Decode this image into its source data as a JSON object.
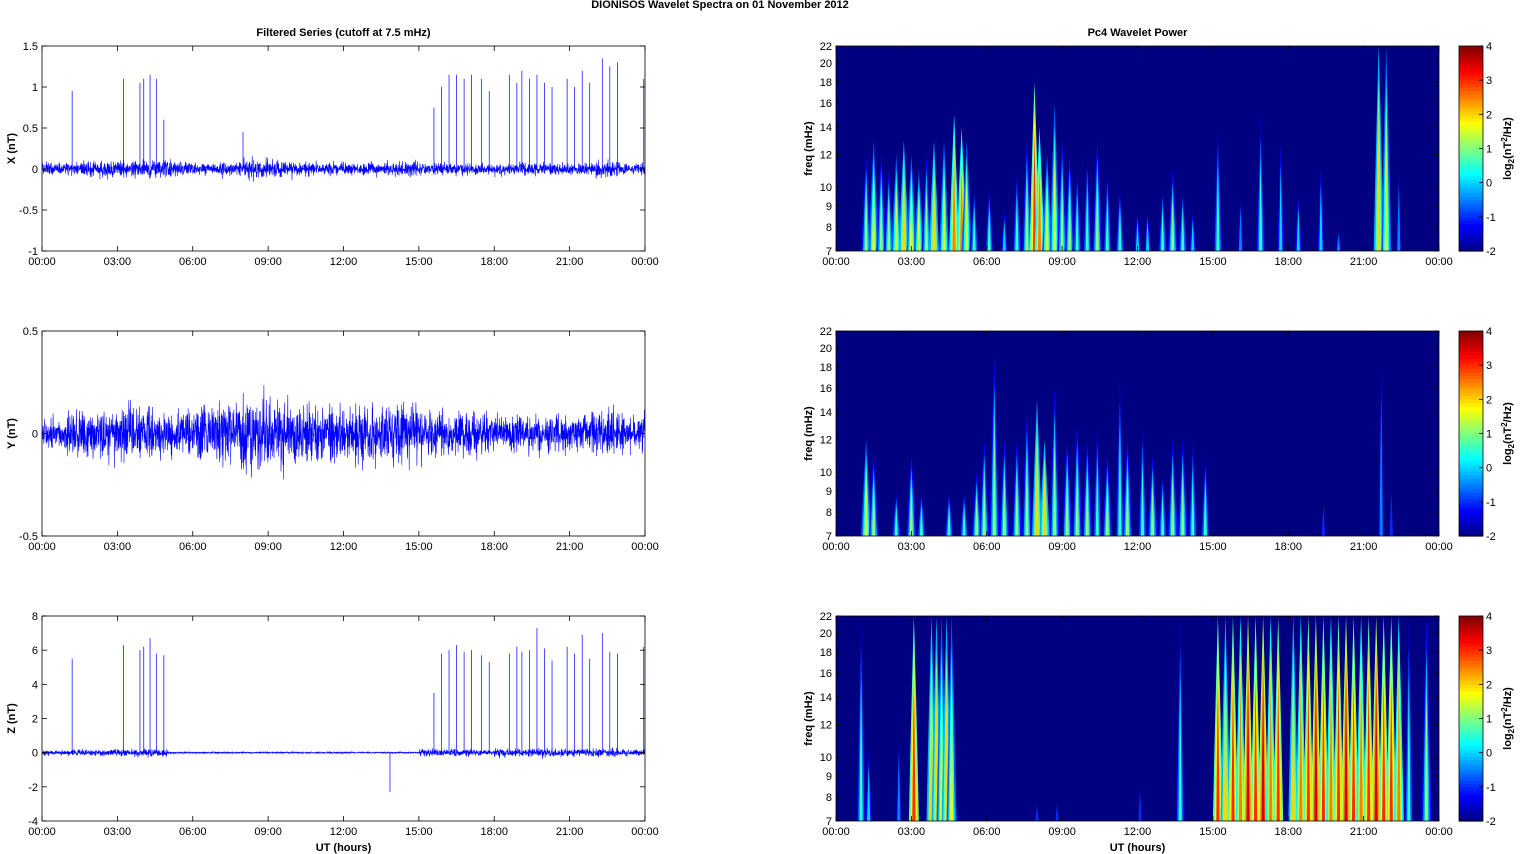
{
  "title": "DIONISOS Wavelet Spectra on 01 November  2012",
  "chart_data": [
    {
      "type": "line",
      "title": "Filtered Series (cutoff at 7.5 mHz)",
      "ylabel": "X (nT)",
      "xlabel": "",
      "xlim": [
        0,
        24
      ],
      "xticks": [
        "00:00",
        "03:00",
        "06:00",
        "09:00",
        "12:00",
        "15:00",
        "18:00",
        "21:00",
        "00:00"
      ],
      "ylim": [
        -1,
        1.5
      ],
      "yticks": [
        "-1",
        "-0.5",
        "0",
        "0.5",
        "1",
        "1.5"
      ],
      "color": "#0000ff",
      "noise_amplitude_hourly": [
        0.05,
        0.06,
        0.07,
        0.07,
        0.08,
        0.07,
        0.05,
        0.06,
        0.08,
        0.07,
        0.06,
        0.05,
        0.05,
        0.05,
        0.06,
        0.05,
        0.05,
        0.05,
        0.05,
        0.05,
        0.05,
        0.05,
        0.07,
        0.05
      ],
      "spikes": [
        [
          1.2,
          0.95
        ],
        [
          3.25,
          1.1
        ],
        [
          3.9,
          1.05
        ],
        [
          4.05,
          1.1
        ],
        [
          4.3,
          1.15
        ],
        [
          4.55,
          1.1
        ],
        [
          4.85,
          0.6
        ],
        [
          8.0,
          0.45
        ],
        [
          15.6,
          0.75
        ],
        [
          15.9,
          1.0
        ],
        [
          16.2,
          1.15
        ],
        [
          16.5,
          1.15
        ],
        [
          16.8,
          1.1
        ],
        [
          17.1,
          1.15
        ],
        [
          17.5,
          1.1
        ],
        [
          17.8,
          0.95
        ],
        [
          18.6,
          1.15
        ],
        [
          18.9,
          1.05
        ],
        [
          19.1,
          1.2
        ],
        [
          19.4,
          1.1
        ],
        [
          19.7,
          1.15
        ],
        [
          20.0,
          1.05
        ],
        [
          20.3,
          1.0
        ],
        [
          20.9,
          1.1
        ],
        [
          21.2,
          1.0
        ],
        [
          21.5,
          1.2
        ],
        [
          21.8,
          1.05
        ],
        [
          22.3,
          1.35
        ],
        [
          22.6,
          1.25
        ],
        [
          22.9,
          1.3
        ],
        [
          23.95,
          1.1
        ]
      ]
    },
    {
      "type": "line",
      "title": "",
      "ylabel": "Y (nT)",
      "xlabel": "",
      "xlim": [
        0,
        24
      ],
      "xticks": [
        "00:00",
        "03:00",
        "06:00",
        "09:00",
        "12:00",
        "15:00",
        "18:00",
        "21:00",
        "00:00"
      ],
      "ylim": [
        -0.5,
        0.5
      ],
      "yticks": [
        "-0.5",
        "0",
        "0.5"
      ],
      "color": "#0000ff",
      "noise_amplitude_hourly": [
        0.05,
        0.09,
        0.08,
        0.09,
        0.08,
        0.08,
        0.09,
        0.1,
        0.12,
        0.11,
        0.1,
        0.09,
        0.1,
        0.1,
        0.1,
        0.08,
        0.07,
        0.07,
        0.06,
        0.06,
        0.06,
        0.06,
        0.08,
        0.06
      ],
      "spikes": []
    },
    {
      "type": "line",
      "title": "",
      "ylabel": "Z (nT)",
      "xlabel": "UT (hours)",
      "xlim": [
        0,
        24
      ],
      "xticks": [
        "00:00",
        "03:00",
        "06:00",
        "09:00",
        "12:00",
        "15:00",
        "18:00",
        "21:00",
        "00:00"
      ],
      "ylim": [
        -4,
        8
      ],
      "yticks": [
        "-4",
        "-2",
        "0",
        "2",
        "4",
        "6",
        "8"
      ],
      "color": "#0000ff",
      "noise_amplitude_hourly": [
        0.1,
        0.12,
        0.13,
        0.15,
        0.16,
        0.04,
        0.03,
        0.03,
        0.03,
        0.03,
        0.03,
        0.03,
        0.03,
        0.03,
        0.03,
        0.15,
        0.15,
        0.12,
        0.18,
        0.18,
        0.18,
        0.17,
        0.17,
        0.12
      ],
      "spikes": [
        [
          1.2,
          5.5
        ],
        [
          3.25,
          6.3
        ],
        [
          3.9,
          6.0
        ],
        [
          4.05,
          6.2
        ],
        [
          4.3,
          6.7
        ],
        [
          4.55,
          5.8
        ],
        [
          4.85,
          5.7
        ],
        [
          13.85,
          -2.3
        ],
        [
          15.6,
          3.5
        ],
        [
          15.9,
          5.8
        ],
        [
          16.2,
          6.0
        ],
        [
          16.5,
          6.3
        ],
        [
          16.8,
          5.9
        ],
        [
          17.1,
          6.0
        ],
        [
          17.5,
          5.7
        ],
        [
          17.8,
          5.3
        ],
        [
          18.6,
          5.8
        ],
        [
          18.9,
          6.2
        ],
        [
          19.1,
          5.9
        ],
        [
          19.4,
          6.0
        ],
        [
          19.7,
          7.3
        ],
        [
          20.0,
          6.1
        ],
        [
          20.3,
          5.4
        ],
        [
          20.9,
          6.2
        ],
        [
          21.2,
          5.8
        ],
        [
          21.5,
          6.9
        ],
        [
          21.8,
          5.5
        ],
        [
          22.3,
          7.0
        ],
        [
          22.6,
          5.9
        ],
        [
          22.9,
          5.8
        ],
        [
          23.95,
          6.2
        ]
      ]
    },
    {
      "type": "heatmap",
      "title": "Pc4 Wavelet Power",
      "ylabel": "freq (mHz)",
      "xlabel": "",
      "xlim": [
        0,
        24
      ],
      "xticks": [
        "00:00",
        "03:00",
        "06:00",
        "09:00",
        "12:00",
        "15:00",
        "18:00",
        "21:00",
        "00:00"
      ],
      "ylim": [
        7,
        22
      ],
      "yscale": "log",
      "yticks": [
        7,
        8,
        9,
        10,
        12,
        14,
        16,
        18,
        20,
        22
      ],
      "background_power": -2,
      "bursts_t_fmax_power": [
        [
          1.2,
          12,
          1
        ],
        [
          1.5,
          13,
          1.5
        ],
        [
          1.8,
          12,
          1
        ],
        [
          2.1,
          11,
          1
        ],
        [
          2.4,
          12,
          1.5
        ],
        [
          2.7,
          13,
          2
        ],
        [
          3.0,
          12,
          1.5
        ],
        [
          3.3,
          11,
          1.5
        ],
        [
          3.6,
          12,
          1
        ],
        [
          3.9,
          13,
          2
        ],
        [
          4.3,
          13,
          1.5
        ],
        [
          4.7,
          15,
          2.5
        ],
        [
          5.0,
          14,
          2.5
        ],
        [
          5.2,
          13,
          1.5
        ],
        [
          5.5,
          10,
          0.5
        ],
        [
          6.1,
          10,
          0.5
        ],
        [
          6.7,
          9,
          0
        ],
        [
          7.2,
          11,
          0.5
        ],
        [
          7.6,
          13,
          1
        ],
        [
          7.9,
          18,
          3
        ],
        [
          8.1,
          14,
          2.5
        ],
        [
          8.4,
          12,
          1.5
        ],
        [
          8.7,
          16,
          1.5
        ],
        [
          9.0,
          13,
          1
        ],
        [
          9.3,
          12,
          1
        ],
        [
          9.6,
          11,
          0.5
        ],
        [
          10.0,
          12,
          0.5
        ],
        [
          10.4,
          13,
          1
        ],
        [
          10.8,
          11,
          0.5
        ],
        [
          11.3,
          10,
          0.5
        ],
        [
          12.0,
          9,
          0
        ],
        [
          12.4,
          9,
          0
        ],
        [
          13.0,
          10,
          0.5
        ],
        [
          13.4,
          11,
          1
        ],
        [
          13.8,
          10,
          0.5
        ],
        [
          14.2,
          9,
          0
        ],
        [
          15.2,
          14,
          0.5
        ],
        [
          16.1,
          10,
          -0.5
        ],
        [
          16.9,
          15,
          0.5
        ],
        [
          17.7,
          14,
          0
        ],
        [
          18.4,
          10,
          0
        ],
        [
          19.3,
          12,
          0
        ],
        [
          20.0,
          8,
          -0.5
        ],
        [
          21.6,
          22,
          2
        ],
        [
          21.9,
          22,
          1.5
        ],
        [
          22.4,
          12,
          -0.5
        ]
      ]
    },
    {
      "type": "heatmap",
      "title": "",
      "ylabel": "freq (mHz)",
      "xlabel": "",
      "xlim": [
        0,
        24
      ],
      "xticks": [
        "00:00",
        "03:00",
        "06:00",
        "09:00",
        "12:00",
        "15:00",
        "18:00",
        "21:00",
        "00:00"
      ],
      "ylim": [
        7,
        22
      ],
      "yscale": "log",
      "yticks": [
        7,
        8,
        9,
        10,
        12,
        14,
        16,
        18,
        20,
        22
      ],
      "background_power": -2,
      "bursts_t_fmax_power": [
        [
          1.2,
          12,
          1.5
        ],
        [
          1.5,
          11,
          1
        ],
        [
          2.4,
          9,
          0.5
        ],
        [
          3.0,
          11,
          1
        ],
        [
          3.4,
          9,
          0.5
        ],
        [
          4.5,
          9,
          0.5
        ],
        [
          5.1,
          9,
          0.5
        ],
        [
          5.6,
          10,
          1
        ],
        [
          5.9,
          12,
          1
        ],
        [
          6.3,
          19,
          1
        ],
        [
          6.7,
          12,
          1
        ],
        [
          7.2,
          12,
          1
        ],
        [
          7.6,
          14,
          1
        ],
        [
          8.0,
          15,
          2
        ],
        [
          8.3,
          12,
          2
        ],
        [
          8.7,
          16,
          1
        ],
        [
          9.2,
          12,
          1
        ],
        [
          9.6,
          13,
          1
        ],
        [
          10.0,
          12,
          1
        ],
        [
          10.4,
          13,
          0.5
        ],
        [
          10.8,
          11,
          1
        ],
        [
          11.3,
          17,
          0.5
        ],
        [
          11.6,
          12,
          1
        ],
        [
          12.2,
          13,
          0.5
        ],
        [
          12.6,
          11,
          1
        ],
        [
          13.0,
          10,
          0.5
        ],
        [
          13.4,
          12,
          1
        ],
        [
          13.8,
          12,
          1
        ],
        [
          14.2,
          12,
          0.5
        ],
        [
          14.7,
          11,
          0.5
        ],
        [
          19.4,
          9,
          -1
        ],
        [
          21.7,
          22,
          -0.5
        ],
        [
          22.1,
          10,
          -1
        ]
      ]
    },
    {
      "type": "heatmap",
      "title": "",
      "ylabel": "freq (mHz)",
      "xlabel": "UT (hours)",
      "xlim": [
        0,
        24
      ],
      "xticks": [
        "00:00",
        "03:00",
        "06:00",
        "09:00",
        "12:00",
        "15:00",
        "18:00",
        "21:00",
        "00:00"
      ],
      "ylim": [
        7,
        22
      ],
      "yscale": "log",
      "yticks": [
        7,
        8,
        9,
        10,
        12,
        14,
        16,
        18,
        20,
        22
      ],
      "background_power": -2,
      "bursts_t_fmax_power": [
        [
          1.0,
          22,
          0.5
        ],
        [
          1.3,
          11,
          0
        ],
        [
          2.5,
          12,
          -0.5
        ],
        [
          3.1,
          22,
          3
        ],
        [
          3.8,
          22,
          2
        ],
        [
          4.0,
          22,
          2
        ],
        [
          4.2,
          22,
          1.5
        ],
        [
          4.4,
          22,
          2
        ],
        [
          4.6,
          22,
          1.5
        ],
        [
          8.0,
          8,
          -1
        ],
        [
          8.8,
          8,
          -1
        ],
        [
          12.1,
          9,
          -1
        ],
        [
          13.7,
          22,
          0.5
        ],
        [
          15.2,
          22,
          3
        ],
        [
          15.5,
          22,
          2
        ],
        [
          15.8,
          22,
          3
        ],
        [
          16.1,
          22,
          2.5
        ],
        [
          16.4,
          22,
          3.5
        ],
        [
          16.7,
          22,
          3
        ],
        [
          17.0,
          22,
          3.5
        ],
        [
          17.3,
          22,
          2.5
        ],
        [
          17.6,
          22,
          3
        ],
        [
          18.2,
          22,
          2
        ],
        [
          18.5,
          22,
          2.5
        ],
        [
          18.8,
          22,
          3
        ],
        [
          19.1,
          22,
          3.5
        ],
        [
          19.4,
          22,
          3
        ],
        [
          19.7,
          22,
          2.5
        ],
        [
          20.0,
          22,
          3
        ],
        [
          20.3,
          22,
          3.5
        ],
        [
          20.6,
          22,
          3
        ],
        [
          20.9,
          22,
          2.5
        ],
        [
          21.2,
          22,
          3
        ],
        [
          21.5,
          22,
          3.5
        ],
        [
          21.8,
          22,
          3
        ],
        [
          22.1,
          22,
          3
        ],
        [
          22.4,
          22,
          2.5
        ],
        [
          22.8,
          22,
          0.5
        ],
        [
          23.5,
          22,
          1
        ]
      ]
    }
  ],
  "colorbar": {
    "range": [
      -2,
      4
    ],
    "ticks": [
      "-2",
      "-1",
      "0",
      "1",
      "2",
      "3",
      "4"
    ],
    "label_parts": {
      "pre": "log",
      "sub": "2",
      "mid": "(nT",
      "sup": "2",
      "post": "/Hz)"
    }
  }
}
